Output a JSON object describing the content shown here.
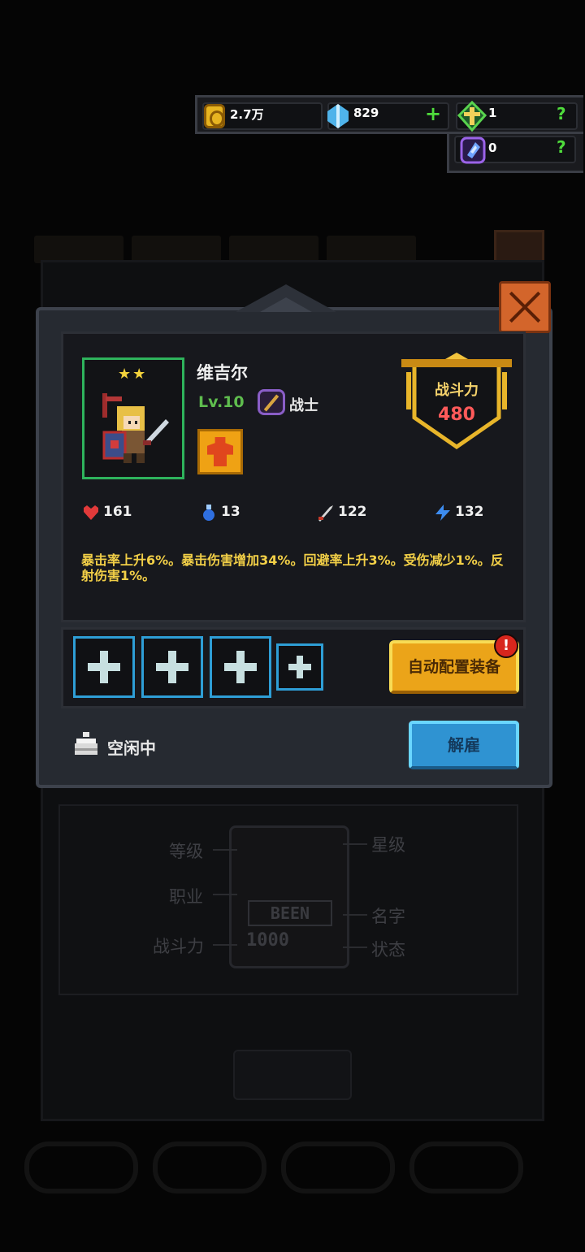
{
  "currency": {
    "gold": "2.7万",
    "gems": "829",
    "add_symbol": "+",
    "token_a": "1",
    "token_b": "0",
    "help_a": "?",
    "help_b": "?"
  },
  "hero": {
    "stars": "★★",
    "name": "维吉尔",
    "level": "Lv.10",
    "class": "战士",
    "power_label": "战斗力",
    "power_value": "480",
    "stats": {
      "hp": "161",
      "mp": "13",
      "attack": "122",
      "speed": "132"
    },
    "description": "暴击率上升6%。暴击伤害增加34%。回避率上升3%。受伤减少1%。反射伤害1%。"
  },
  "equipment": {
    "slot_symbol": "+",
    "auto_button": "自动配置装备",
    "alert": "!"
  },
  "status": {
    "text": "空闲中",
    "dismiss_button": "解雇"
  },
  "background_guide": {
    "level": "等级",
    "class": "职业",
    "power": "战斗力",
    "star": "星级",
    "name": "名字",
    "state": "状态",
    "card_name": "BEEN",
    "card_power": "1000"
  },
  "colors": {
    "gold": "#e7b421",
    "gem": "#4fb3ea",
    "frame_green": "#2eb35c",
    "slot_blue": "#2e9ed6",
    "auto_orange": "#eba419",
    "dismiss_blue": "#2f93d2",
    "power_red": "#ff5a5a",
    "desc_yellow": "#f2cf47"
  }
}
